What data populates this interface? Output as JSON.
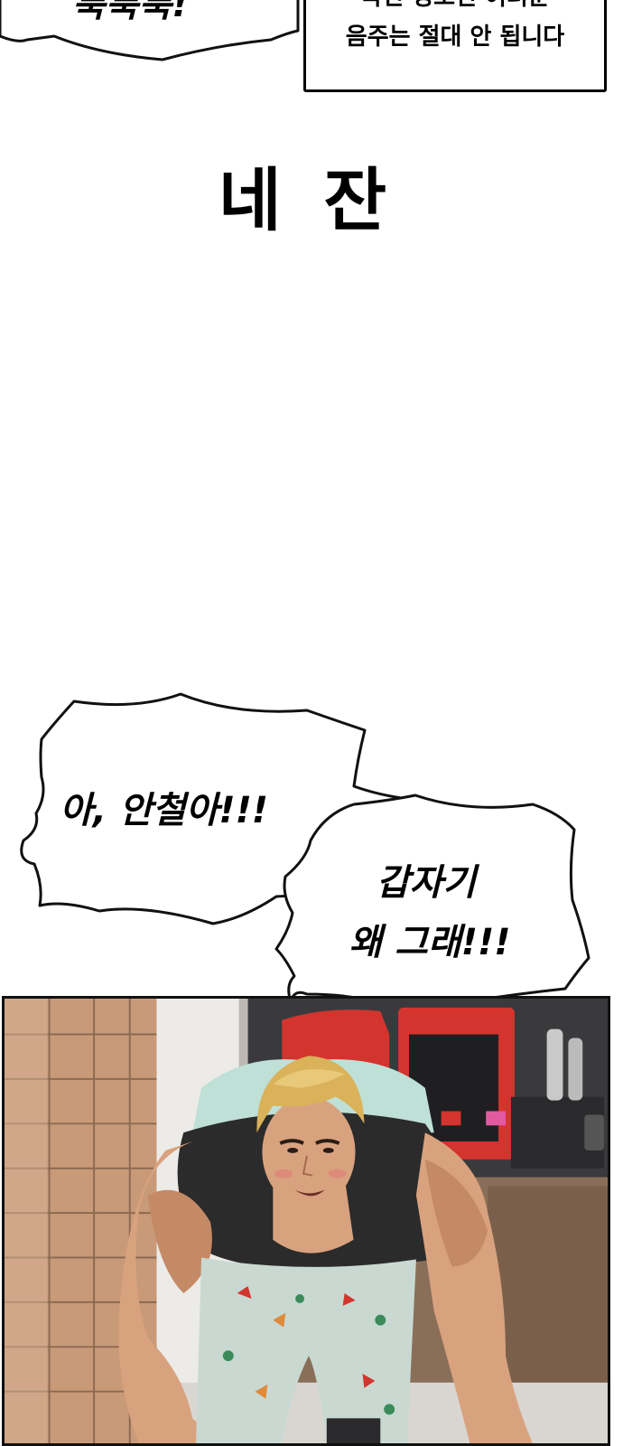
{
  "top_bubble": {
    "text": "툭툭툭!"
  },
  "caption": {
    "line1": "국민 영도인 여러분",
    "line2": "음주는 절대 안 됩니다"
  },
  "narration": {
    "text": "네 잔"
  },
  "bubble_left": {
    "text": "아, 안철아!!!"
  },
  "bubble_right": {
    "line1": "갑자기",
    "line2": "왜 그래!!!"
  },
  "panel": {
    "description_icon": "comic-panel-illustration",
    "colors": {
      "skin": "#d9a27f",
      "hair": "#d9b25a",
      "shirt": "#2b2b2b",
      "shorts": "#c9d9d2",
      "machine_red": "#d4342e",
      "brick": "#c99a78"
    }
  }
}
